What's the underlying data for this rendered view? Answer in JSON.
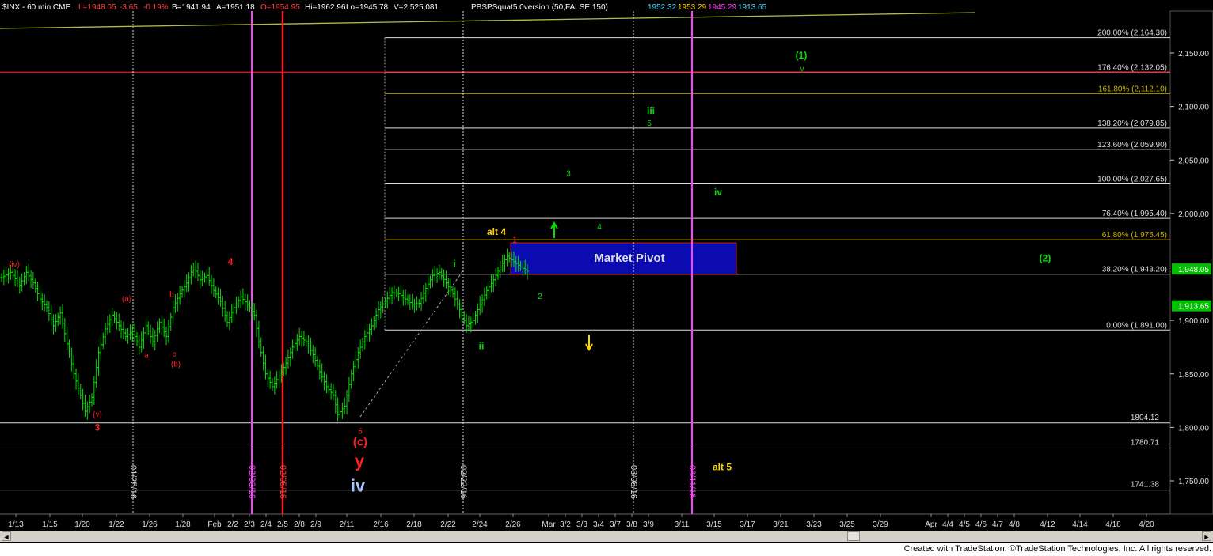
{
  "header": {
    "symbol": "$INX - 60 min  CME",
    "stats": [
      "L=1948.05",
      "-3.65",
      "-0.19%",
      "B=1941.94",
      "A=1951.18",
      "O=1954.95",
      "Hi=1962.96",
      "Lo=1945.78",
      "V=2,525,081"
    ],
    "indicator": "PBSPSquat5.0version (50,FALSE,150)",
    "indicator_values": [
      "1952.32",
      "1953.29",
      "1945.29",
      "1913.65"
    ]
  },
  "colors": {
    "background": "#000000",
    "bars": "#00e000",
    "fib": "#ffffff",
    "fib_gold": "#c8b400",
    "green_label": "#00e000",
    "red_label": "#ff2020",
    "magenta": "#ff40ff",
    "pivot_fill": "#0b0bb0",
    "price_box": "#00c000",
    "yellow": "#ffd700"
  },
  "chart_data": {
    "type": "bar",
    "title": "$INX - 60 min",
    "ylim": [
      1715,
      2185
    ],
    "y_ticks": [
      2150,
      2100,
      2050,
      2000,
      1950,
      1900,
      1850,
      1800,
      1750
    ],
    "y_tick_labels": [
      "2,150.00",
      "2,100.00",
      "2,050.00",
      "2,000.00",
      "1,950.00",
      "1,900.00",
      "1,850.00",
      "1,800.00",
      "1,750.00"
    ],
    "x_labels": [
      "1/13",
      "1/15",
      "1/20",
      "1/22",
      "1/26",
      "1/28",
      "Feb",
      "2/2",
      "2/3",
      "2/4",
      "2/5",
      "2/8",
      "2/9",
      "2/11",
      "2/16",
      "2/18",
      "2/22",
      "2/24",
      "2/26",
      "Mar",
      "3/2",
      "3/3",
      "3/4",
      "3/7",
      "3/8",
      "3/9",
      "3/11",
      "3/15",
      "3/17",
      "3/21",
      "3/23",
      "3/25",
      "3/29",
      "Apr",
      "4/4",
      "4/5",
      "4/6",
      "4/7",
      "4/8",
      "4/12",
      "4/14",
      "4/18",
      "4/20"
    ],
    "price_path": [
      [
        0,
        1940
      ],
      [
        4,
        1945
      ],
      [
        8,
        1933
      ],
      [
        11,
        1945
      ],
      [
        14,
        1935
      ],
      [
        17,
        1920
      ],
      [
        20,
        1912
      ],
      [
        23,
        1895
      ],
      [
        26,
        1907
      ],
      [
        29,
        1878
      ],
      [
        32,
        1850
      ],
      [
        35,
        1830
      ],
      [
        37,
        1815
      ],
      [
        40,
        1828
      ],
      [
        43,
        1870
      ],
      [
        46,
        1892
      ],
      [
        49,
        1905
      ],
      [
        52,
        1895
      ],
      [
        55,
        1885
      ],
      [
        58,
        1890
      ],
      [
        61,
        1875
      ],
      [
        64,
        1895
      ],
      [
        67,
        1880
      ],
      [
        70,
        1898
      ],
      [
        73,
        1885
      ],
      [
        76,
        1912
      ],
      [
        79,
        1925
      ],
      [
        82,
        1935
      ],
      [
        85,
        1950
      ],
      [
        88,
        1938
      ],
      [
        91,
        1942
      ],
      [
        94,
        1928
      ],
      [
        97,
        1918
      ],
      [
        100,
        1898
      ],
      [
        103,
        1912
      ],
      [
        106,
        1922
      ],
      [
        109,
        1915
      ],
      [
        112,
        1905
      ],
      [
        114,
        1880
      ],
      [
        117,
        1850
      ],
      [
        120,
        1838
      ],
      [
        123,
        1848
      ],
      [
        126,
        1860
      ],
      [
        129,
        1875
      ],
      [
        132,
        1885
      ],
      [
        135,
        1880
      ],
      [
        138,
        1868
      ],
      [
        141,
        1852
      ],
      [
        144,
        1838
      ],
      [
        147,
        1830
      ],
      [
        149,
        1812
      ],
      [
        152,
        1820
      ],
      [
        155,
        1850
      ],
      [
        158,
        1870
      ],
      [
        161,
        1885
      ],
      [
        164,
        1895
      ],
      [
        167,
        1910
      ],
      [
        170,
        1918
      ],
      [
        173,
        1926
      ],
      [
        176,
        1925
      ],
      [
        179,
        1920
      ],
      [
        182,
        1915
      ],
      [
        185,
        1916
      ],
      [
        188,
        1930
      ],
      [
        191,
        1942
      ],
      [
        194,
        1945
      ],
      [
        197,
        1935
      ],
      [
        200,
        1925
      ],
      [
        203,
        1910
      ],
      [
        206,
        1895
      ],
      [
        209,
        1900
      ],
      [
        212,
        1915
      ],
      [
        215,
        1928
      ],
      [
        218,
        1938
      ],
      [
        221,
        1950
      ],
      [
        224,
        1960
      ],
      [
        227,
        1955
      ],
      [
        230,
        1950
      ],
      [
        233,
        1946
      ]
    ],
    "fib_levels": [
      {
        "label": "200.00% (2,164.30)",
        "value": 2164.3
      },
      {
        "label": "176.40% (2,132.05)",
        "value": 2132.05
      },
      {
        "label": "161.80% (2,112.10)",
        "value": 2112.1,
        "gold": true
      },
      {
        "label": "138.20% (2,079.85)",
        "value": 2079.85
      },
      {
        "label": "123.60% (2,059.90)",
        "value": 2059.9
      },
      {
        "label": "100.00% (2,027.65)",
        "value": 2027.65
      },
      {
        "label": "76.40% (1,995.40)",
        "value": 1995.4
      },
      {
        "label": "61.80% (1,975.45)",
        "value": 1975.45,
        "gold": true
      },
      {
        "label": "38.20% (1,943.20)",
        "value": 1943.2
      },
      {
        "label": "0.00% (1,891.00)",
        "value": 1891.0
      }
    ],
    "support_levels": [
      {
        "label": "1804.12",
        "value": 1804.12
      },
      {
        "label": "1780.71",
        "value": 1780.71
      },
      {
        "label": "1741.38",
        "value": 1741.38
      }
    ],
    "price_markers": [
      {
        "label": "1,948.05",
        "value": 1948.05
      },
      {
        "label": "1,913.65",
        "value": 1913.65
      }
    ],
    "date_lines": [
      {
        "label": "01/25/16",
        "color": "white"
      },
      {
        "label": "02/03/16",
        "color": "magenta"
      },
      {
        "label": "02/05/16",
        "color": "red"
      },
      {
        "label": "02/22/16",
        "color": "white"
      },
      {
        "label": "03/08/16",
        "color": "white"
      },
      {
        "label": "03/11/16",
        "color": "magenta"
      }
    ],
    "pivot_zone": {
      "label": "Market Pivot",
      "top": 1975.45,
      "bottom": 1943.2
    },
    "wave_labels": [
      {
        "text": "(iv)",
        "color": "red",
        "price": 1950
      },
      {
        "text": "(v)",
        "color": "red",
        "price": 1810
      },
      {
        "text": "3",
        "color": "red",
        "price": 1797
      },
      {
        "text": "(a)",
        "color": "red",
        "price": 1918
      },
      {
        "text": "a",
        "color": "red",
        "price": 1865
      },
      {
        "text": "b",
        "color": "red",
        "price": 1922
      },
      {
        "text": "c",
        "color": "red",
        "price": 1866
      },
      {
        "text": "(b)",
        "color": "red",
        "price": 1857
      },
      {
        "text": "4",
        "color": "red",
        "price": 1952
      },
      {
        "text": "5",
        "color": "red",
        "price": 1794
      },
      {
        "text": "(c)",
        "color": "red",
        "price": 1783
      },
      {
        "text": "y",
        "color": "red",
        "price": 1763
      },
      {
        "text": "iv",
        "color": "blue",
        "price": 1740
      },
      {
        "text": "i",
        "color": "green",
        "price": 1950
      },
      {
        "text": "ii",
        "color": "green",
        "price": 1873
      },
      {
        "text": "alt 4",
        "color": "yellow",
        "price": 1980
      },
      {
        "text": "1",
        "color": "red",
        "price": 1973
      },
      {
        "text": "2",
        "color": "green",
        "price": 1920
      },
      {
        "text": "3",
        "color": "green",
        "price": 2035
      },
      {
        "text": "4",
        "color": "green",
        "price": 1985
      },
      {
        "text": "iii",
        "color": "green",
        "price": 2093
      },
      {
        "text": "5",
        "color": "green",
        "price": 2082
      },
      {
        "text": "iv",
        "color": "green",
        "price": 2017
      },
      {
        "text": "(1)",
        "color": "green",
        "price": 2145
      },
      {
        "text": "v",
        "color": "green",
        "price": 2133
      },
      {
        "text": "(2)",
        "color": "green",
        "price": 1955
      },
      {
        "text": "alt 5",
        "color": "yellow",
        "price": 1760
      }
    ]
  },
  "footer": {
    "text": "Created with TradeStation. ©TradeStation Technologies, Inc. All rights reserved."
  },
  "scrollbar": {
    "left_arrow": "◄",
    "right_arrow": "►"
  }
}
